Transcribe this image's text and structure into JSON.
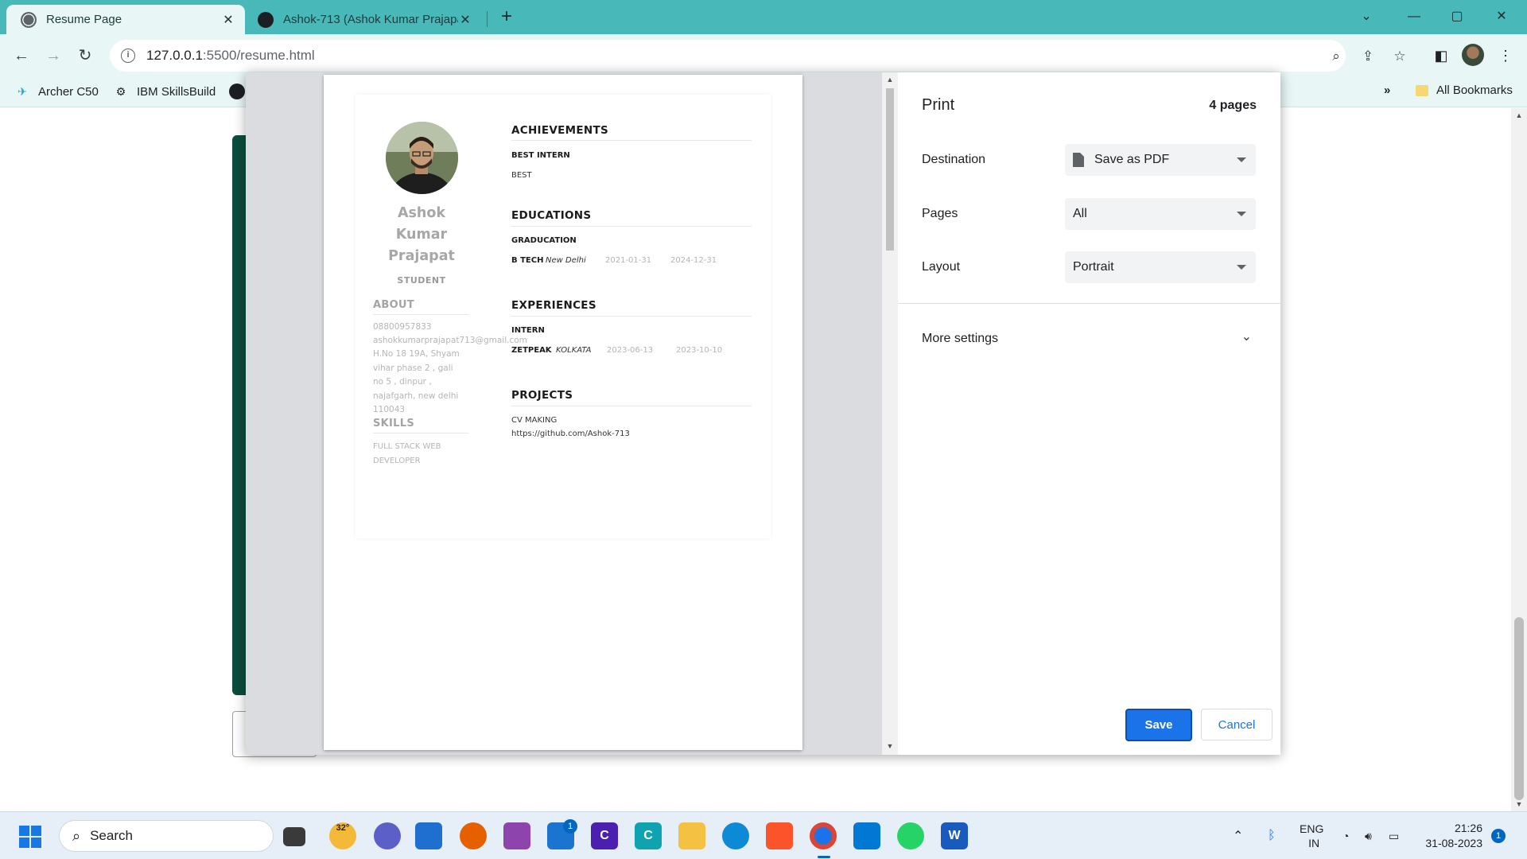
{
  "browser": {
    "tabs": [
      {
        "title": "Resume Page",
        "close": "✕"
      },
      {
        "title": "Ashok-713 (Ashok Kumar Prajapa",
        "close": "✕"
      }
    ],
    "new_tab": "+",
    "window_controls": {
      "minimize": "—",
      "maximize": "▢",
      "close": "✕",
      "tab_search": "⌄"
    },
    "nav": {
      "back": "←",
      "forward": "→",
      "reload": "↻"
    },
    "url_host": "127.0.0.1",
    "url_path": ":5500/resume.html",
    "bookmarks": [
      {
        "label": "Archer C50",
        "icon": "✈"
      },
      {
        "label": "IBM SkillsBuild",
        "icon": "⚙"
      }
    ],
    "bookmarks_more": "»",
    "all_bookmarks": "All Bookmarks"
  },
  "print": {
    "title": "Print",
    "page_count": "4 pages",
    "destination_label": "Destination",
    "destination_value": "Save as PDF",
    "pages_label": "Pages",
    "pages_value": "All",
    "layout_label": "Layout",
    "layout_value": "Portrait",
    "more_settings": "More settings",
    "save": "Save",
    "cancel": "Cancel"
  },
  "resume": {
    "name": [
      "Ashok",
      "Kumar",
      "Prajapat"
    ],
    "role": "STUDENT",
    "about_heading": "ABOUT",
    "phone": "08800957833",
    "email": "ashokkumarprajapat713@gmail.com",
    "address": [
      "H.No 18 19A, Shyam",
      "vihar phase 2 , gali",
      "no 5 , dinpur ,",
      "najafgarh, new delhi",
      "110043"
    ],
    "skills_heading": "SKILLS",
    "skills": [
      "FULL STACK WEB",
      "DEVELOPER"
    ],
    "achievements_heading": "ACHIEVEMENTS",
    "achievement_title": "BEST INTERN",
    "achievement_desc": "BEST",
    "educations_heading": "EDUCATIONS",
    "education_title": "GRADUCATION",
    "education_degree": "B TECH",
    "education_place": "New Delhi",
    "education_start": "2021-01-31",
    "education_end": "2024-12-31",
    "experiences_heading": "EXPERIENCES",
    "experience_title": "INTERN",
    "experience_company": "ZETPEAK",
    "experience_place": "KOLKATA",
    "experience_start": "2023-06-13",
    "experience_end": "2023-10-10",
    "projects_heading": "PROJECTS",
    "project_title": "CV MAKING",
    "project_link": "https://github.com/Ashok-713"
  },
  "taskbar": {
    "search_placeholder": "Search",
    "weather_temp": "32°",
    "mail_badge": "1",
    "lang_top": "ENG",
    "lang_bottom": "IN",
    "time": "21:26",
    "date": "31-08-2023",
    "notification_count": "1"
  },
  "colors": {
    "tab_strip": "#48b8b8",
    "toolbar": "#e9f6f6",
    "accent_blue": "#1a73e8",
    "page_green": "#0d4d3d"
  }
}
